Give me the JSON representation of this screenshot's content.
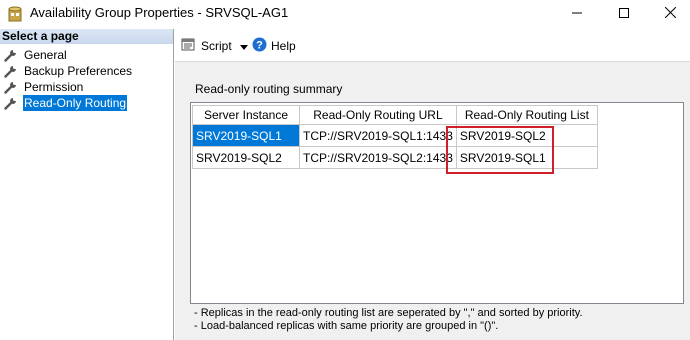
{
  "window": {
    "title": "Availability Group Properties - SRVSQL-AG1"
  },
  "sidebar": {
    "header": "Select a page",
    "items": [
      {
        "label": "General",
        "icon": "wrench-icon",
        "selected": false
      },
      {
        "label": "Backup Preferences",
        "icon": "wrench-icon",
        "selected": false
      },
      {
        "label": "Permission",
        "icon": "wrench-icon",
        "selected": false
      },
      {
        "label": "Read-Only Routing",
        "icon": "wrench-icon",
        "selected": true
      }
    ]
  },
  "toolbar": {
    "script_label": "Script",
    "help_label": "Help"
  },
  "main": {
    "section_label": "Read-only routing summary",
    "table": {
      "columns": [
        "Server Instance",
        "Read-Only Routing URL",
        "Read-Only Routing List"
      ],
      "rows": [
        [
          "SRV2019-SQL1",
          "TCP://SRV2019-SQL1:1433",
          "SRV2019-SQL2"
        ],
        [
          "SRV2019-SQL2",
          "TCP://SRV2019-SQL2:1433",
          "SRV2019-SQL1"
        ]
      ]
    },
    "notes": [
      "- Replicas in the read-only routing list are seperated by \",\" and sorted by priority.",
      "- Load-balanced replicas with same priority are grouped in \"()\"."
    ]
  },
  "colors": {
    "selection": "#0078d7",
    "highlight_box": "#d01f2a",
    "content_bg": "#f0f0f0"
  }
}
